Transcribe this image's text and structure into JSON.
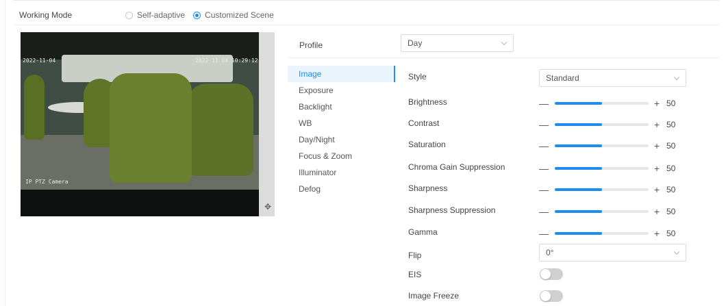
{
  "working_mode": {
    "label": "Working Mode",
    "options": [
      "Self-adaptive",
      "Customized Scene"
    ],
    "selected": "Customized Scene"
  },
  "preview": {
    "osd_top_left": "2022-11-04",
    "osd_top_right": "2022 11 04 10:29:12",
    "osd_bottom_left": "IP PTZ Camera"
  },
  "profile": {
    "label": "Profile",
    "value": "Day"
  },
  "nav": {
    "items": [
      "Image",
      "Exposure",
      "Backlight",
      "WB",
      "Day/Night",
      "Focus & Zoom",
      "Illuminator",
      "Defog"
    ],
    "active": "Image"
  },
  "settings": {
    "style": {
      "label": "Style",
      "value": "Standard"
    },
    "sliders": [
      {
        "label": "Brightness",
        "value": 50
      },
      {
        "label": "Contrast",
        "value": 50
      },
      {
        "label": "Saturation",
        "value": 50
      },
      {
        "label": "Chroma Gain Suppression",
        "value": 50
      },
      {
        "label": "Sharpness",
        "value": 50
      },
      {
        "label": "Sharpness Suppression",
        "value": 50
      },
      {
        "label": "Gamma",
        "value": 50
      }
    ],
    "flip": {
      "label": "Flip",
      "value": "0°"
    },
    "eis": {
      "label": "EIS",
      "on": false
    },
    "image_freeze": {
      "label": "Image Freeze",
      "on": false
    }
  },
  "colors": {
    "accent": "#1e8cf0",
    "track": "#e7e7e7",
    "toggle_off": "#d0d0d0"
  }
}
